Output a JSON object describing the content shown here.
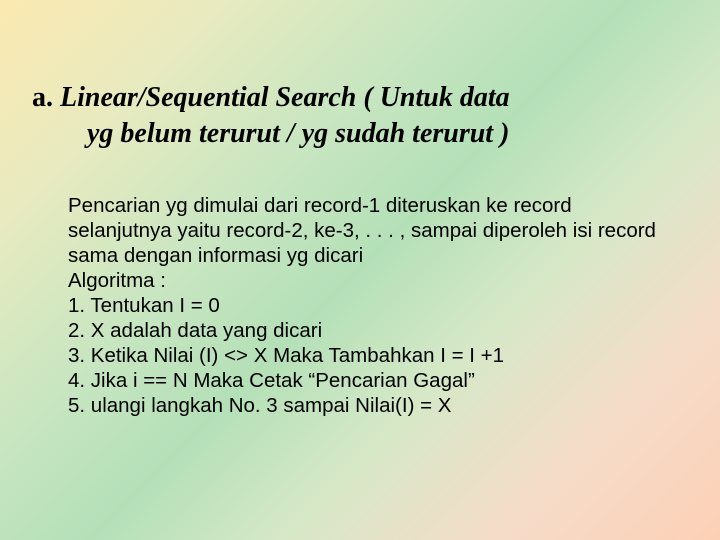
{
  "heading": {
    "prefix": "a.",
    "line1_rest": " Linear/Sequential Search  ( Untuk data",
    "line2": "yg belum terurut / yg sudah terurut )"
  },
  "body": {
    "p1": "Pencarian yg dimulai dari record-1 diteruskan ke record selanjutnya yaitu record-2, ke-3, . . . , sampai diperoleh isi record sama dengan informasi yg dicari",
    "p2": "Algoritma :",
    "p3": "1. Tentukan I = 0",
    "p4": "2. X adalah data yang dicari",
    "p5": "3. Ketika Nilai (I) <> X Maka Tambahkan I = I +1",
    "p6": "4. Jika i == N Maka Cetak “Pencarian Gagal”",
    "p7": "5. ulangi langkah No. 3 sampai Nilai(I) = X"
  }
}
